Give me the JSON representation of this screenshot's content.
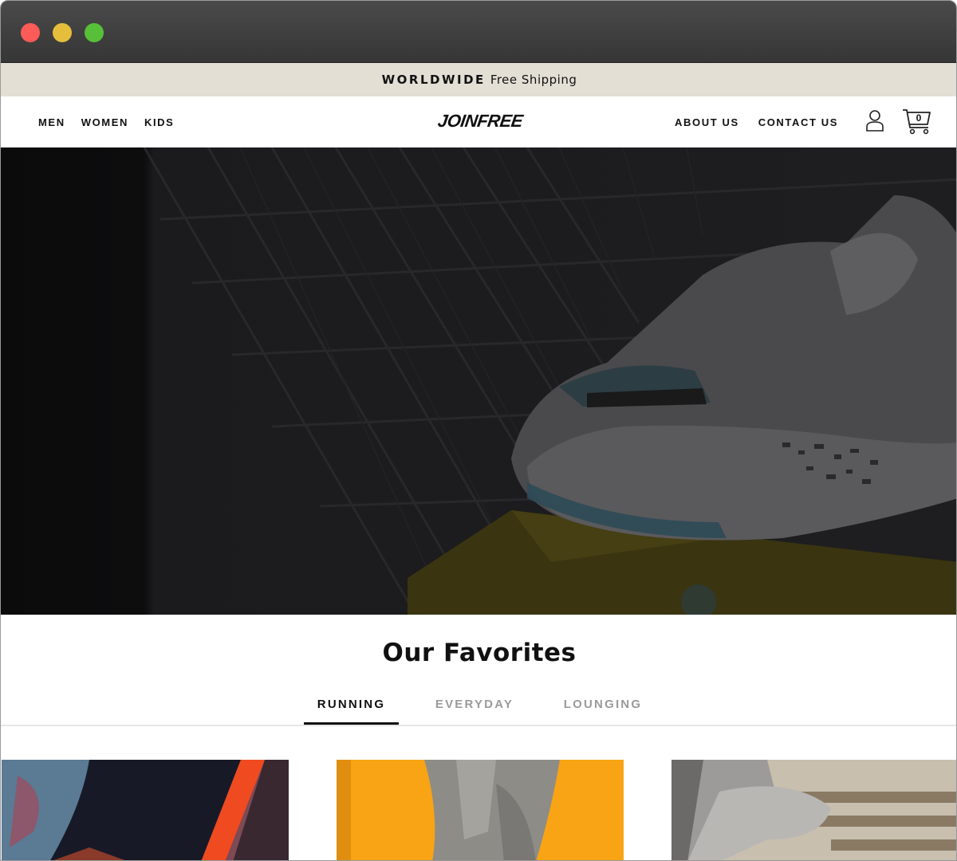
{
  "announcement": {
    "highlight": "WORLDWIDE",
    "text": "Free Shipping"
  },
  "nav": {
    "left": [
      "MEN",
      "WOMEN",
      "KIDS"
    ],
    "right": [
      "ABOUT US",
      "CONTACT US"
    ],
    "logo": "JOINFREE",
    "cart_count": "0"
  },
  "section": {
    "title": "Our Favorites",
    "tabs": [
      {
        "label": "RUNNING",
        "active": true
      },
      {
        "label": "EVERYDAY",
        "active": false
      },
      {
        "label": "LOUNGING",
        "active": false
      }
    ]
  },
  "icons": [
    "user-icon",
    "cart-icon"
  ]
}
